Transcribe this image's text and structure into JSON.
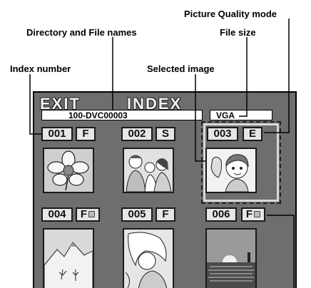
{
  "callouts": {
    "picture_quality_mode": "Picture Quality mode",
    "directory_file_names": "Directory and File names",
    "file_size": "File size",
    "index_number": "Index number",
    "selected_image": "Selected image"
  },
  "screen": {
    "exit_label": "EXIT",
    "index_title": "INDEX",
    "directory_file": "100-DVC00003",
    "file_size_value": "VGA",
    "thumbnails": [
      {
        "number": "001",
        "mode": "F",
        "locked": false,
        "image": "flower"
      },
      {
        "number": "002",
        "mode": "S",
        "locked": false,
        "image": "people"
      },
      {
        "number": "003",
        "mode": "E",
        "locked": false,
        "image": "cartoon-girl",
        "selected": true
      },
      {
        "number": "004",
        "mode": "F",
        "locked": true,
        "image": "mountains"
      },
      {
        "number": "005",
        "mode": "F",
        "locked": false,
        "image": "woman-hair"
      },
      {
        "number": "006",
        "mode": "F",
        "locked": true,
        "image": "sunset-sea"
      }
    ]
  }
}
